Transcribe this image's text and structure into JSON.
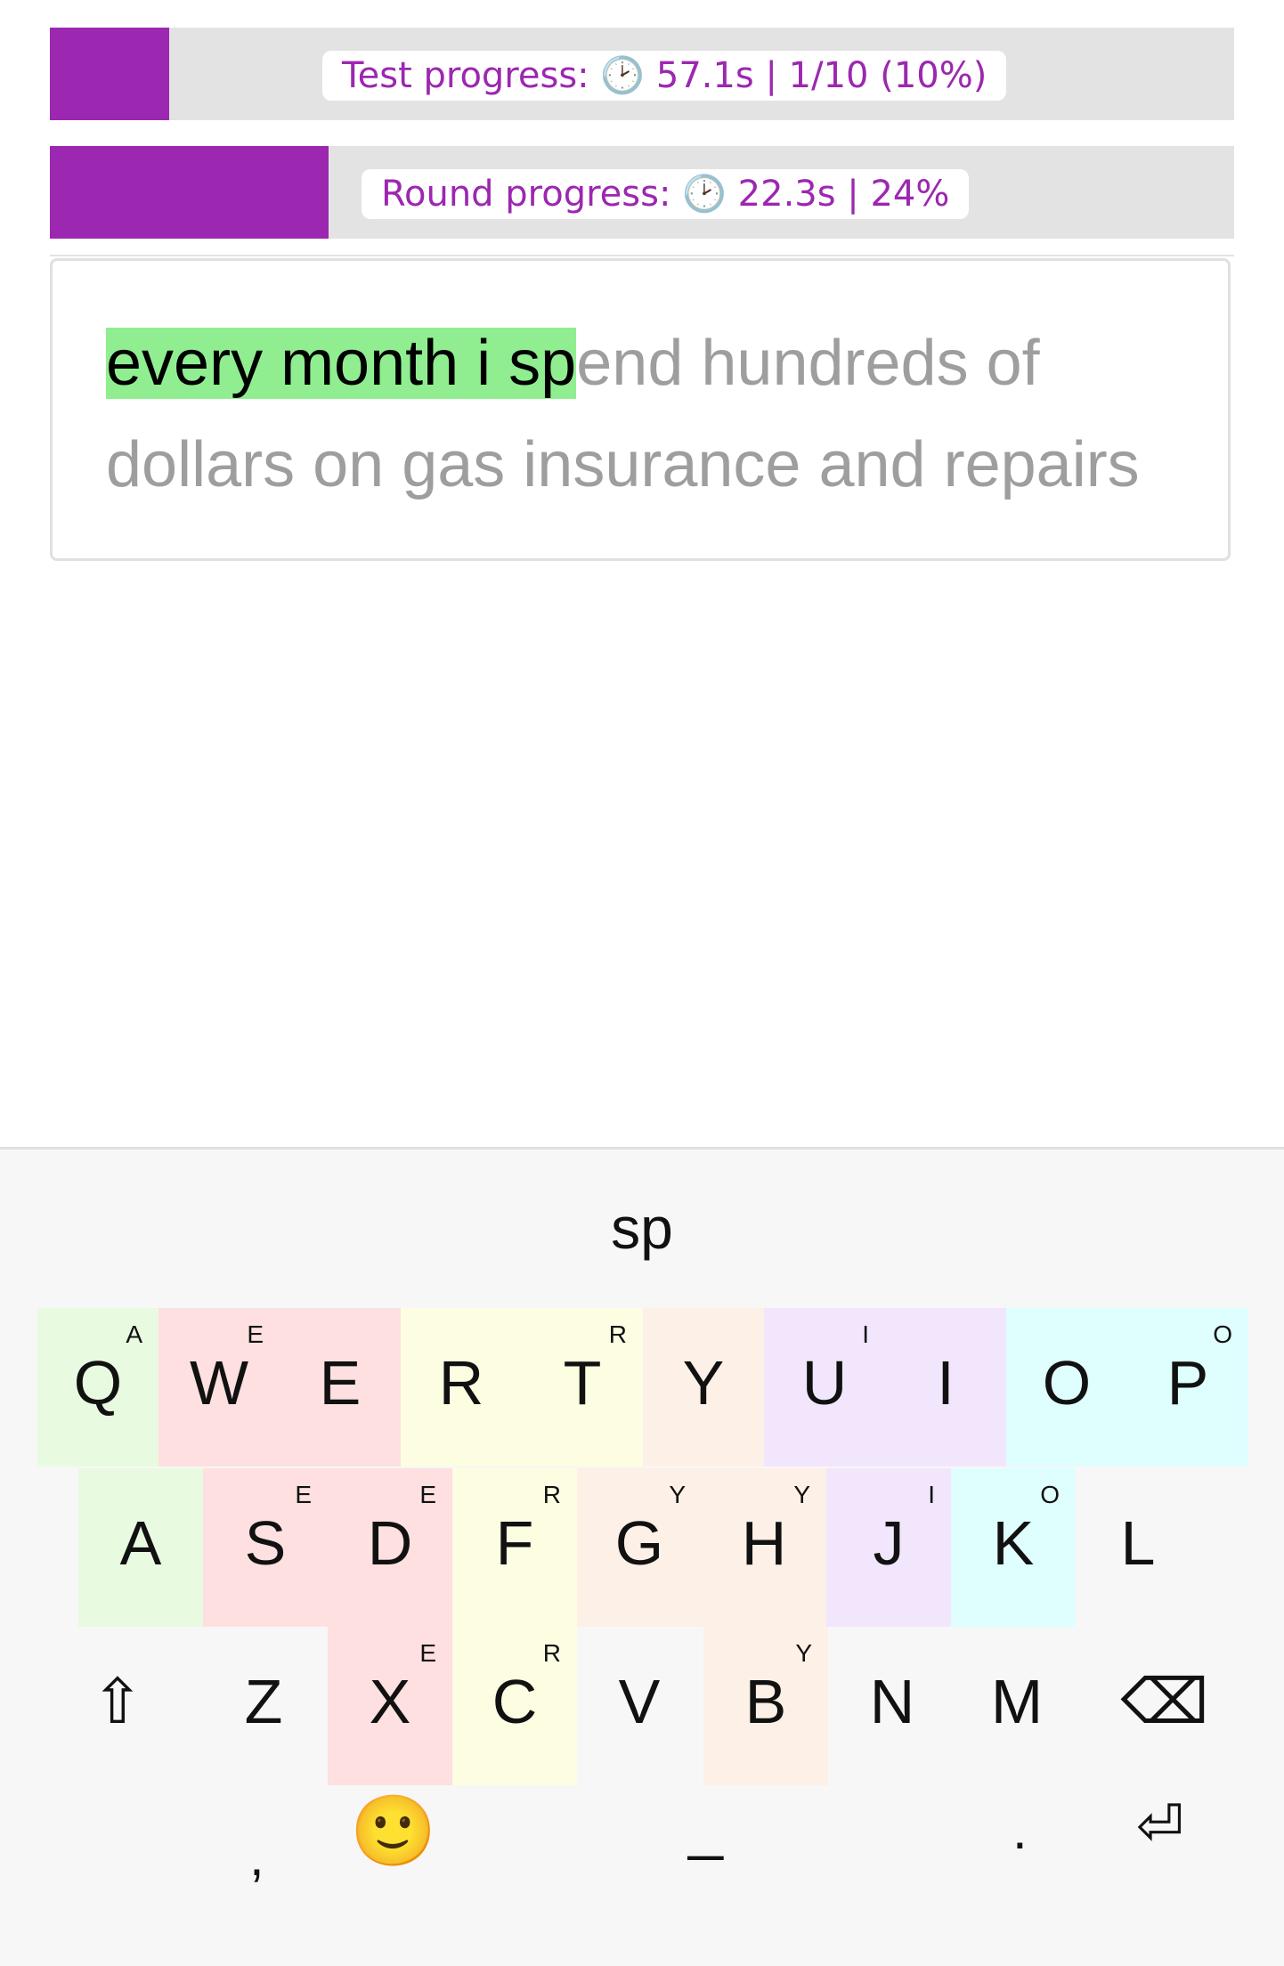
{
  "test_progress": {
    "label": "Test progress: 🕑 57.1s | 1/10 (10%)",
    "fraction": 0.1
  },
  "round_progress": {
    "label": "Round progress: 🕑 22.3s | 24%",
    "fraction": 0.24
  },
  "prompt": {
    "typed": "every month i sp",
    "remaining": "end hundreds of dollars on gas insurance and repairs"
  },
  "keyboard": {
    "composing_text": "sp",
    "colors": {
      "green": "#e8fbe1",
      "red": "#fde0df",
      "yellow": "#fdfde2",
      "peach": "#fdf0e6",
      "purple": "#f2e6fd",
      "cyan": "#dffefe",
      "none": "#f7f7f7"
    },
    "row1": [
      {
        "label": "Q",
        "sup": "A",
        "color": "green"
      },
      {
        "label": "W",
        "sup": "E",
        "color": "red"
      },
      {
        "label": "E",
        "sup": "",
        "color": "red"
      },
      {
        "label": "R",
        "sup": "",
        "color": "yellow"
      },
      {
        "label": "T",
        "sup": "R",
        "color": "yellow"
      },
      {
        "label": "Y",
        "sup": "",
        "color": "peach"
      },
      {
        "label": "U",
        "sup": "I",
        "color": "purple"
      },
      {
        "label": "I",
        "sup": "",
        "color": "purple"
      },
      {
        "label": "O",
        "sup": "",
        "color": "cyan"
      },
      {
        "label": "P",
        "sup": "O",
        "color": "cyan"
      }
    ],
    "row2": [
      {
        "label": "A",
        "sup": "",
        "color": "green"
      },
      {
        "label": "S",
        "sup": "E",
        "color": "red"
      },
      {
        "label": "D",
        "sup": "E",
        "color": "red"
      },
      {
        "label": "F",
        "sup": "R",
        "color": "yellow"
      },
      {
        "label": "G",
        "sup": "Y",
        "color": "peach"
      },
      {
        "label": "H",
        "sup": "Y",
        "color": "peach"
      },
      {
        "label": "J",
        "sup": "I",
        "color": "purple"
      },
      {
        "label": "K",
        "sup": "O",
        "color": "cyan"
      },
      {
        "label": "L",
        "sup": "",
        "color": "none"
      }
    ],
    "row3": [
      {
        "label": "⇧",
        "sup": "",
        "color": "none"
      },
      {
        "label": "Z",
        "sup": "",
        "color": "none"
      },
      {
        "label": "X",
        "sup": "E",
        "color": "red"
      },
      {
        "label": "C",
        "sup": "R",
        "color": "yellow"
      },
      {
        "label": "V",
        "sup": "",
        "color": "none"
      },
      {
        "label": "B",
        "sup": "Y",
        "color": "peach"
      },
      {
        "label": "N",
        "sup": "",
        "color": "none"
      },
      {
        "label": "M",
        "sup": "",
        "color": "none"
      },
      {
        "label": "⌫",
        "sup": "",
        "color": "none"
      }
    ],
    "bottom": {
      "comma": ",",
      "emoji": "🙂",
      "space": "_",
      "period": ".",
      "enter": "⏎"
    }
  }
}
